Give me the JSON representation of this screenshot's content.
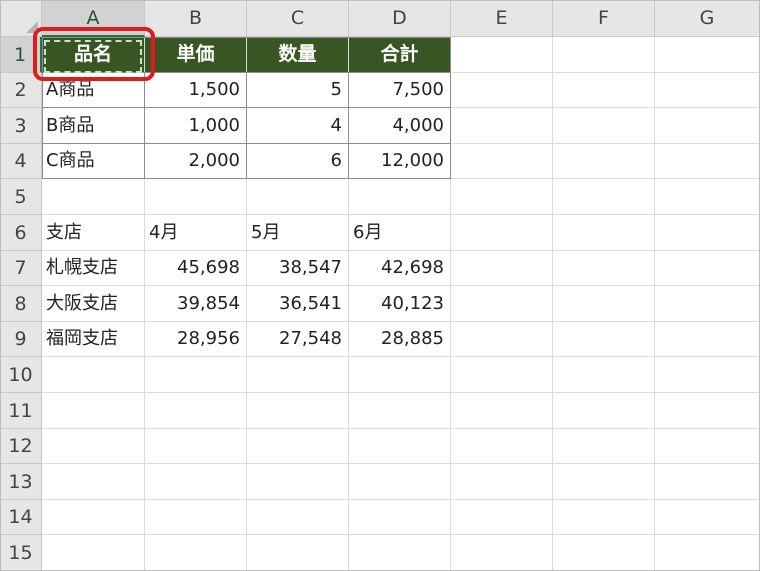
{
  "columns": [
    "A",
    "B",
    "C",
    "D",
    "E",
    "F",
    "G"
  ],
  "rows": [
    "1",
    "2",
    "3",
    "4",
    "5",
    "6",
    "7",
    "8",
    "9",
    "10",
    "11",
    "12",
    "13",
    "14",
    "15"
  ],
  "selected_cell": "A1",
  "colors": {
    "header_fill": "#375623",
    "header_text": "#ffffff",
    "highlight": "#e01b1b",
    "selection": "#217346"
  },
  "table1": {
    "headers": [
      "品名",
      "単価",
      "数量",
      "合計"
    ],
    "rows": [
      [
        "A商品",
        "1,500",
        "5",
        "7,500"
      ],
      [
        "B商品",
        "1,000",
        "4",
        "4,000"
      ],
      [
        "C商品",
        "2,000",
        "6",
        "12,000"
      ]
    ]
  },
  "table2": {
    "headers": [
      "支店",
      "4月",
      "5月",
      "6月"
    ],
    "rows": [
      [
        "札幌支店",
        "45,698",
        "38,547",
        "42,698"
      ],
      [
        "大阪支店",
        "39,854",
        "36,541",
        "40,123"
      ],
      [
        "福岡支店",
        "28,956",
        "27,548",
        "28,885"
      ]
    ]
  }
}
